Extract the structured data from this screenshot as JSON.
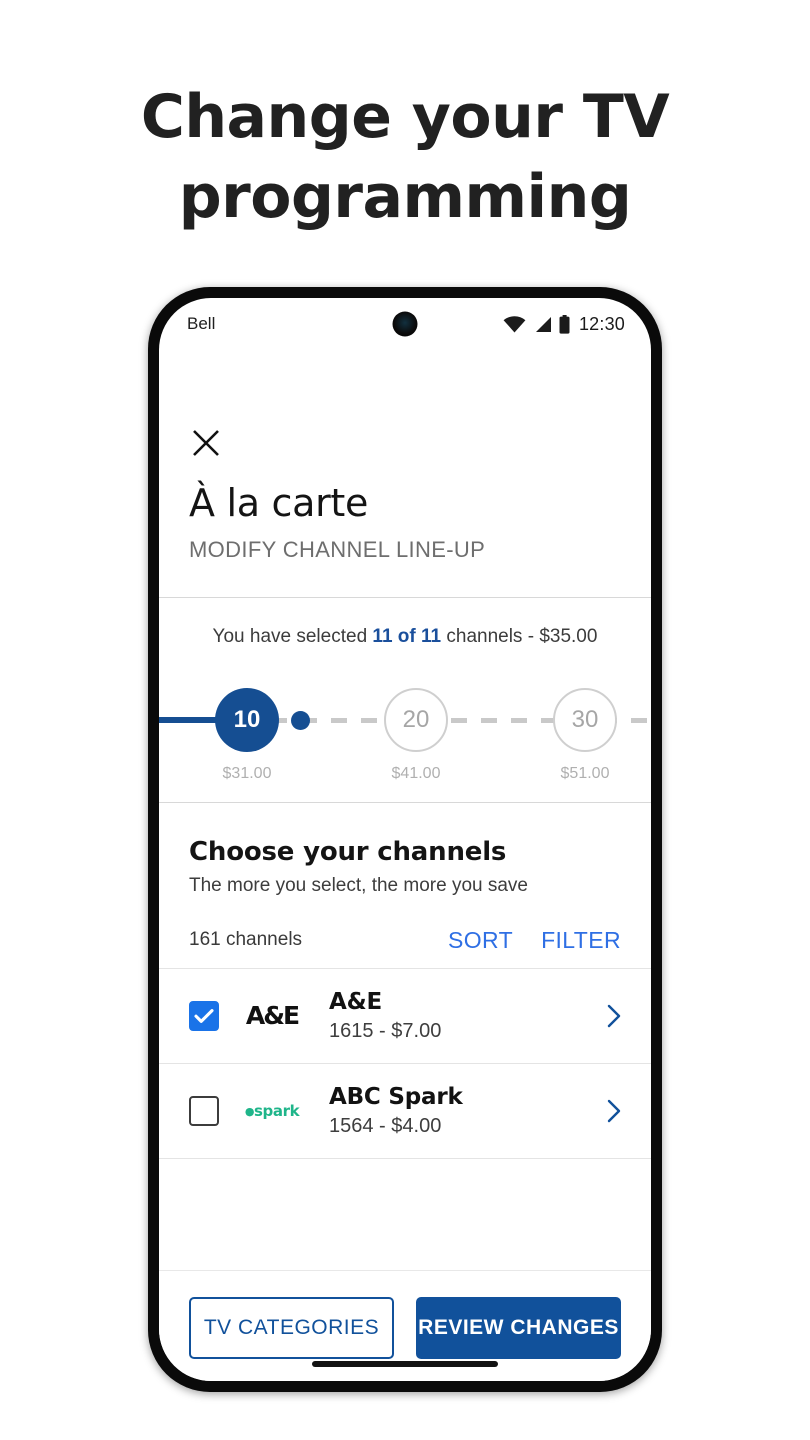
{
  "marketing": {
    "headline_line1": "Change your TV",
    "headline_line2": "programming"
  },
  "status_bar": {
    "carrier": "Bell",
    "clock": "12:30",
    "wifi_icon": "wifi-icon",
    "signal_icon": "signal-icon",
    "battery_icon": "battery-icon",
    "camera_icon": "front-camera-punch-hole"
  },
  "header": {
    "close_icon": "close-icon",
    "title": "À la carte",
    "subtitle": "MODIFY CHANNEL LINE-UP"
  },
  "summary": {
    "prefix": "You have selected ",
    "highlight": "11 of 11",
    "suffix": " channels - $35.00"
  },
  "stepper": {
    "nodes": [
      {
        "label": "10",
        "price": "$31.00",
        "state": "active"
      },
      {
        "label": "20",
        "price": "$41.00",
        "state": "inactive"
      },
      {
        "label": "30",
        "price": "$51.00",
        "state": "inactive"
      }
    ],
    "active_color": "#154e92",
    "inactive_color": "#cfcfcf"
  },
  "choose": {
    "title": "Choose your channels",
    "subtitle": "The more you select, the more you save",
    "count_label": "161 channels",
    "sort_label": "SORT",
    "filter_label": "FILTER",
    "action_color": "#2f6fe4"
  },
  "channels": [
    {
      "name": "A&E",
      "meta": "1615 - $7.00",
      "checked": true,
      "logo_text": "A&E",
      "logo_name": "ae-logo",
      "chevron_icon": "chevron-right-icon"
    },
    {
      "name": "ABC Spark",
      "meta": "1564 - $4.00",
      "checked": false,
      "logo_text": "spark",
      "logo_name": "abc-spark-logo",
      "chevron_icon": "chevron-right-icon"
    }
  ],
  "footer": {
    "secondary_label": "TV CATEGORIES",
    "primary_label": "REVIEW CHANGES",
    "primary_color": "#11519b"
  }
}
